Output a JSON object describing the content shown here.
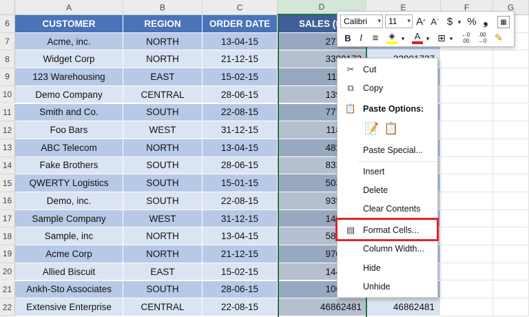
{
  "columns": [
    "A",
    "B",
    "C",
    "D",
    "E",
    "F",
    "G"
  ],
  "selected_column": "D",
  "row_numbers": [
    "6",
    "7",
    "8",
    "9",
    "10",
    "11",
    "12",
    "13",
    "14",
    "15",
    "16",
    "17",
    "18",
    "19",
    "20",
    "21",
    "22"
  ],
  "headers": [
    "CUSTOMER",
    "REGION",
    "ORDER DATE",
    "SALES (th",
    ""
  ],
  "rows": [
    [
      "Acme, inc.",
      "NORTH",
      "13-04-15",
      "2718099",
      ""
    ],
    [
      "Widget Corp",
      "NORTH",
      "21-12-15",
      "3390173",
      "33901737"
    ],
    [
      "123 Warehousing",
      "EAST",
      "15-02-15",
      "1116100",
      ""
    ],
    [
      "Demo Company",
      "CENTRAL",
      "28-06-15",
      "1394345",
      ""
    ],
    [
      "Smith and Co.",
      "SOUTH",
      "22-08-15",
      "7771037",
      ""
    ],
    [
      "Foo Bars",
      "WEST",
      "31-12-15",
      "1181788",
      ""
    ],
    [
      "ABC Telecom",
      "NORTH",
      "13-04-15",
      "4820805",
      ""
    ],
    [
      "Fake Brothers",
      "SOUTH",
      "28-06-15",
      "8335927",
      ""
    ],
    [
      "QWERTY Logistics",
      "SOUTH",
      "15-01-15",
      "5035885",
      ""
    ],
    [
      "Demo, inc.",
      "SOUTH",
      "22-08-15",
      "9355519",
      ""
    ],
    [
      "Sample Company",
      "WEST",
      "31-12-15",
      "1453105",
      ""
    ],
    [
      "Sample, inc",
      "NORTH",
      "13-04-15",
      "5871047",
      ""
    ],
    [
      "Acme Corp",
      "NORTH",
      "21-12-15",
      "9707832",
      ""
    ],
    [
      "Allied Biscuit",
      "EAST",
      "15-02-15",
      "1448880",
      ""
    ],
    [
      "Ankh-Sto Associates",
      "SOUTH",
      "28-06-15",
      "1062983",
      ""
    ],
    [
      "Extensive Enterprise",
      "CENTRAL",
      "22-08-15",
      "46862481",
      "46862481"
    ]
  ],
  "mini_toolbar": {
    "font_name": "Calibri",
    "font_size": "11",
    "grow_font": "A",
    "shrink_font": "A",
    "currency": "$",
    "percent": "%",
    "comma": "❟",
    "bold": "B",
    "italic": "I",
    "align": "≡",
    "fill_color": "#ffff00",
    "font_color": "#e01b1b",
    "increase_decimal": ".00",
    "decrease_decimal": ".00"
  },
  "context_menu": {
    "cut": "Cut",
    "copy": "Copy",
    "paste_options": "Paste Options:",
    "paste_special": "Paste Special...",
    "insert": "Insert",
    "delete": "Delete",
    "clear_contents": "Clear Contents",
    "format_cells": "Format Cells...",
    "column_width": "Column Width...",
    "hide": "Hide",
    "unhide": "Unhide"
  },
  "colors": {
    "header_fill": "#4a73b8",
    "band_dark": "#b7c9e6",
    "band_light": "#dbe4f2",
    "selection": "#217346",
    "highlight": "#e0242e"
  }
}
